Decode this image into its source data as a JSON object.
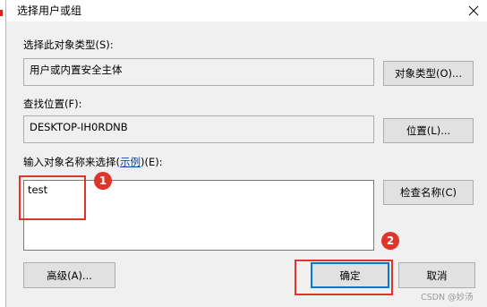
{
  "dialog": {
    "title": "选择用户或组",
    "close_glyph": "✕"
  },
  "object_type": {
    "label": "选择此对象类型(S):",
    "value": "用户或内置安全主体",
    "button_label": "对象类型(O)..."
  },
  "location": {
    "label": "查找位置(F):",
    "value": "DESKTOP-IH0RDNB",
    "button_label": "位置(L)..."
  },
  "object_names": {
    "label_before_link": "输入对象名称来选择(",
    "link_text": "示例",
    "label_after_link": ")(E):",
    "value": "test",
    "check_button_label": "检查名称(C)"
  },
  "footer": {
    "advanced_label": "高级(A)...",
    "ok_label": "确定",
    "cancel_label": "取消"
  },
  "annotations": {
    "step1": "1",
    "step2": "2",
    "color": "#e0342a"
  },
  "watermark": "CSDN @妙汤",
  "icons": {
    "close": "close-icon"
  }
}
